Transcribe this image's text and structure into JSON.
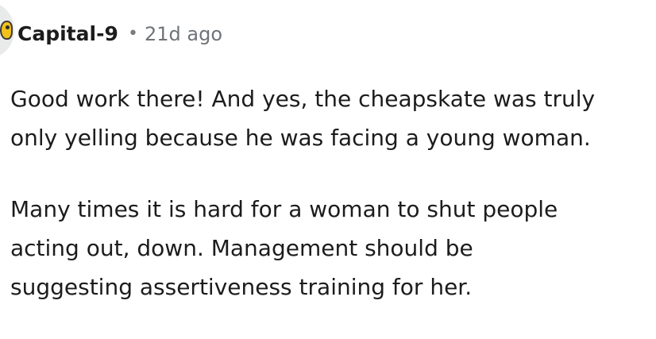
{
  "comment": {
    "author": "Capital-9",
    "separator": "•",
    "timestamp": "21d ago",
    "paragraphs": [
      {
        "lines": [
          "Good work there! And yes, the cheapskate was truly",
          "only yelling because he was facing a young woman."
        ]
      },
      {
        "lines": [
          "Many times it is hard for a woman to shut people",
          "acting out, down. Management should be",
          "suggesting assertiveness training for her."
        ]
      }
    ]
  },
  "icons": {
    "avatar": "user-avatar-icon"
  },
  "colors": {
    "text": "#1c1c1c",
    "meta": "#6f7478",
    "avatar_bg": "#e9eaea",
    "avatar_accent": "#f2c21b"
  }
}
